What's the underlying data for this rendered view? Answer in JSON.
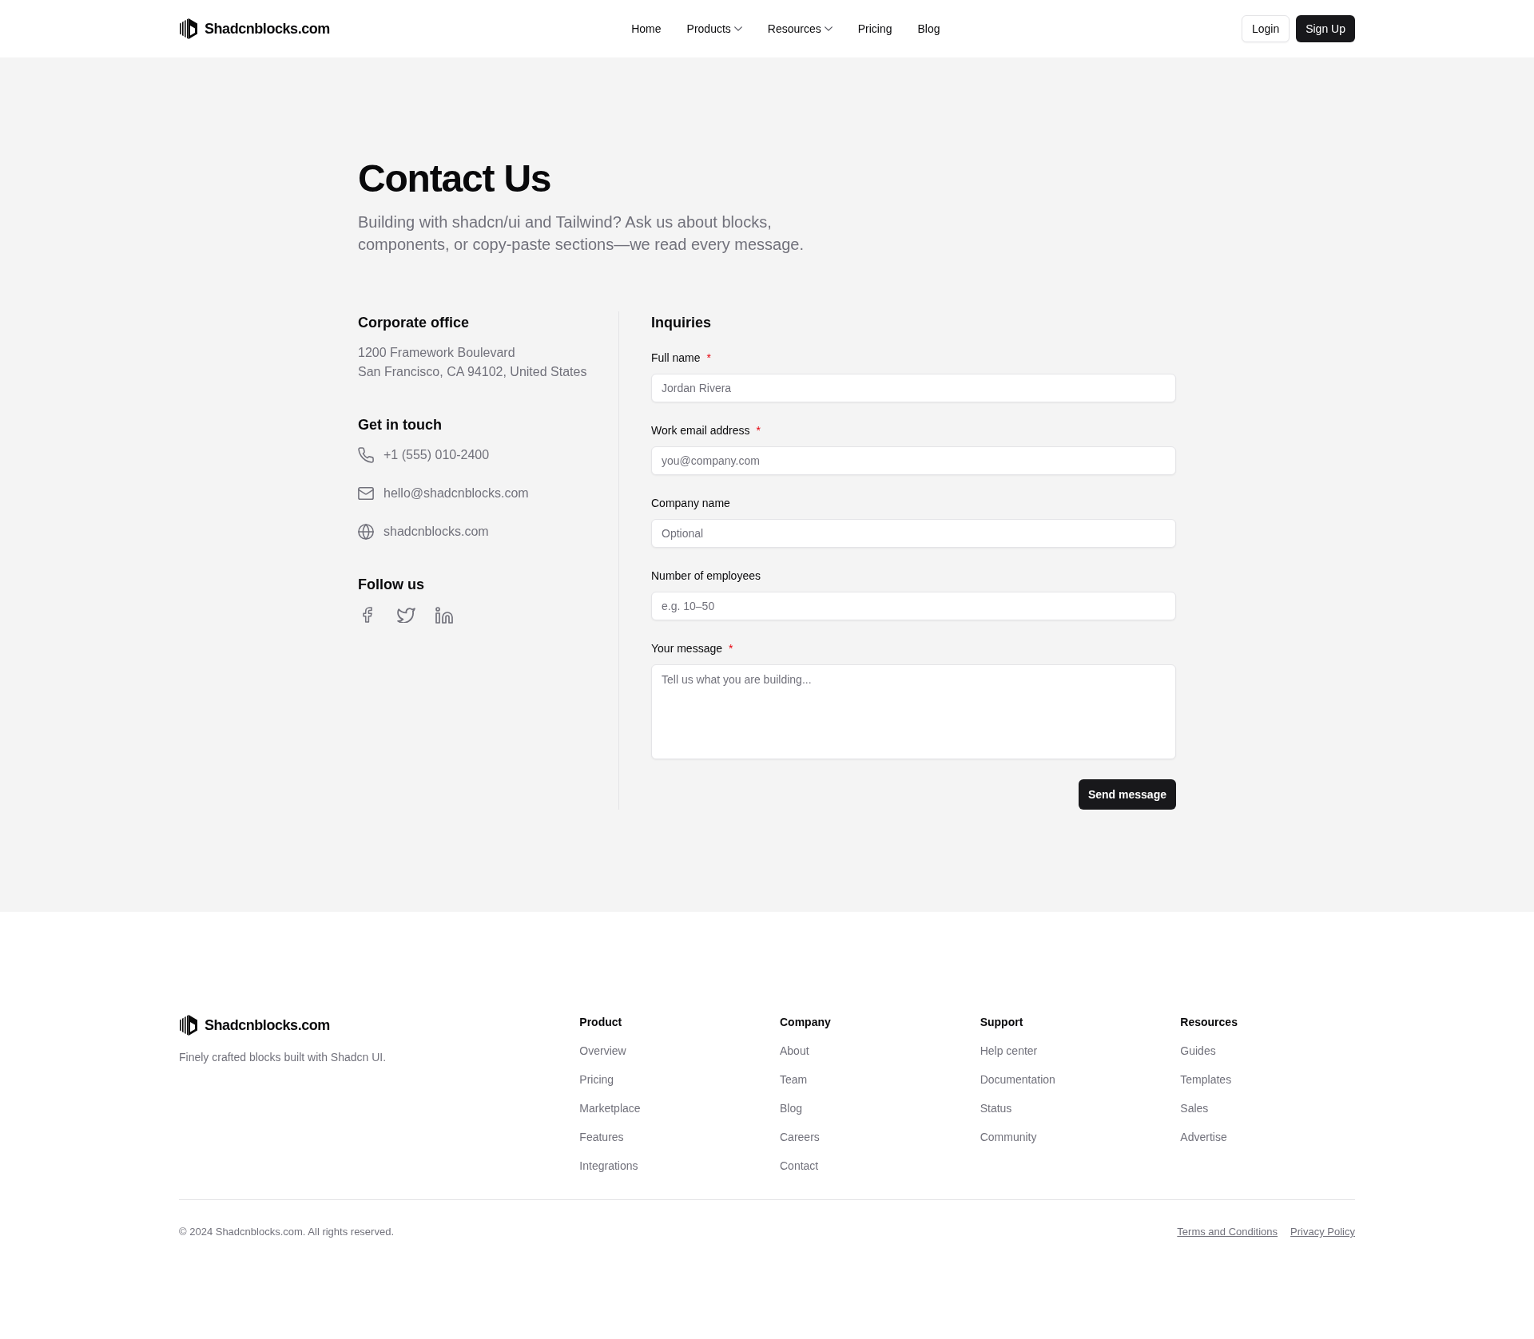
{
  "header": {
    "logo": {
      "text": "Shadcnblocks.com"
    },
    "nav": [
      {
        "label": "Home",
        "has_menu": false
      },
      {
        "label": "Products",
        "has_menu": true
      },
      {
        "label": "Resources",
        "has_menu": true
      },
      {
        "label": "Pricing",
        "has_menu": false
      },
      {
        "label": "Blog",
        "has_menu": false
      }
    ],
    "actions": [
      {
        "label": "Login",
        "kind": "outline"
      },
      {
        "label": "Sign Up",
        "kind": "solid"
      }
    ]
  },
  "hero": {
    "title": "Contact Us",
    "subtitle": "Building with shadcn/ui and Tailwind? Ask us about blocks, components, or copy-paste sections—we read every message."
  },
  "office": {
    "heading": "Corporate office",
    "address_lines": [
      "1200 Framework Boulevard",
      "San Francisco, CA 94102, United States"
    ]
  },
  "contact": {
    "heading": "Get in touch",
    "items": [
      {
        "kind": "phone",
        "text": "+1 (555) 010-2400"
      },
      {
        "kind": "email",
        "text": "hello@shadcnblocks.com"
      },
      {
        "kind": "website",
        "text": "shadcnblocks.com"
      }
    ]
  },
  "social": {
    "heading": "Follow us",
    "links": [
      {
        "kind": "facebook"
      },
      {
        "kind": "twitter"
      },
      {
        "kind": "linkedin"
      }
    ]
  },
  "form": {
    "heading": "Inquiries",
    "fields": [
      {
        "kind": "input",
        "label": "Full name",
        "required_mark": "*",
        "placeholder": "Jordan Rivera"
      },
      {
        "kind": "input",
        "label": "Work email address",
        "required_mark": "*",
        "placeholder": "you@company.com"
      },
      {
        "kind": "input",
        "label": "Company name",
        "placeholder": "Optional"
      },
      {
        "kind": "input",
        "label": "Number of employees",
        "placeholder": "e.g. 10–50"
      },
      {
        "kind": "textarea",
        "label": "Your message",
        "required_mark": "*",
        "placeholder": "Tell us what you are building..."
      }
    ],
    "submit": "Send message"
  },
  "footer": {
    "logo": {
      "text": "Shadcnblocks.com"
    },
    "tagline": "Finely crafted blocks built with Shadcn UI.",
    "columns": [
      {
        "heading": "Product",
        "links": [
          "Overview",
          "Pricing",
          "Marketplace",
          "Features",
          "Integrations"
        ]
      },
      {
        "heading": "Company",
        "links": [
          "About",
          "Team",
          "Blog",
          "Careers",
          "Contact"
        ]
      },
      {
        "heading": "Support",
        "links": [
          "Help center",
          "Documentation",
          "Status",
          "Community"
        ]
      },
      {
        "heading": "Resources",
        "links": [
          "Guides",
          "Templates",
          "Sales",
          "Advertise"
        ]
      }
    ],
    "copyright": "© 2024 Shadcnblocks.com. All rights reserved.",
    "legal_links": [
      "Terms and Conditions",
      "Privacy Policy"
    ]
  }
}
